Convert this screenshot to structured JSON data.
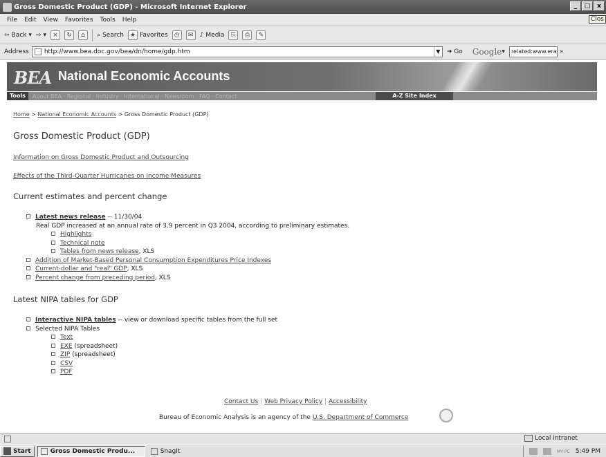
{
  "window": {
    "title": "Gross Domestic Product (GDP) - Microsoft Internet Explorer",
    "buttons": [
      "_",
      "□",
      "x"
    ]
  },
  "tooltip": "Clos",
  "menu": [
    "File",
    "Edit",
    "View",
    "Favorites",
    "Tools",
    "Help"
  ],
  "toolbar": {
    "back": "Back",
    "search": "Search",
    "favorites": "Favorites",
    "media": "Media"
  },
  "address": {
    "label": "Address",
    "url": "http://www.bea.doc.gov/bea/dn/home/gdp.htm",
    "go": "Go",
    "google": "Google",
    "google_query": "related:www.eraidc"
  },
  "banner": {
    "logo": "BEA",
    "title": "National Economic Accounts"
  },
  "navbar": {
    "tools": "Tools",
    "links": "About BEA · Regional · Industry · International · Newsroom · FAQ · Contact",
    "az": "A-Z Site Index"
  },
  "breadcrumb": {
    "home": "Home",
    "nea": "National Economic Accounts",
    "current": "Gross Domestic Product (GDP)",
    "sep": ">"
  },
  "page_title": "Gross Domestic Product (GDP)",
  "links": {
    "outsourcing": "Information on Gross Domestic Product and Outsourcing",
    "hurricanes": "Effects of the Third-Quarter Hurricanes on Income Measures"
  },
  "section_current": {
    "heading": "Current estimates and percent change",
    "news_label": "Latest news release",
    "news_date": " -- 11/30/04",
    "summary": "Real GDP increased at an annual rate of 3.9 percent in Q3 2004, according to preliminary estimates.",
    "sub_items": [
      "Highlights",
      "Technical note",
      "Tables from news release"
    ],
    "tables_suffix": ", XLS",
    "items": [
      {
        "label": "Addition of Market-Based Personal Consumption Expenditures Price Indexes",
        "suffix": ""
      },
      {
        "label": "Current-dollar and \"real\" GDP",
        "suffix": ", XLS"
      },
      {
        "label": "Percent change from preceding period",
        "suffix": ", XLS"
      }
    ]
  },
  "section_nipa": {
    "heading": "Latest NIPA tables for GDP",
    "interactive_label": "Interactive NIPA tables",
    "interactive_desc": " -- view or download specific tables from the full set",
    "selected_label": "Selected NIPA Tables",
    "formats": [
      {
        "label": "Text",
        "note": ""
      },
      {
        "label": "EXE",
        "note": " (spreadsheet)"
      },
      {
        "label": "ZIP",
        "note": " (spreadsheet)"
      },
      {
        "label": "CSV",
        "note": ""
      },
      {
        "label": "PDF",
        "note": ""
      }
    ]
  },
  "footer": {
    "contact": "Contact Us",
    "privacy": "Web Privacy Policy",
    "accessibility": "Accessibility",
    "agency_text": "Bureau of Economic Analysis is an agency of the ",
    "commerce": "U.S. Department of Commerce"
  },
  "statusbar": {
    "zone": "Local intranet"
  },
  "taskbar": {
    "start": "Start",
    "tasks": [
      "Gross Domestic Produ...",
      "SnagIt"
    ],
    "tray_label": "MY PC",
    "clock": "5:49 PM"
  }
}
